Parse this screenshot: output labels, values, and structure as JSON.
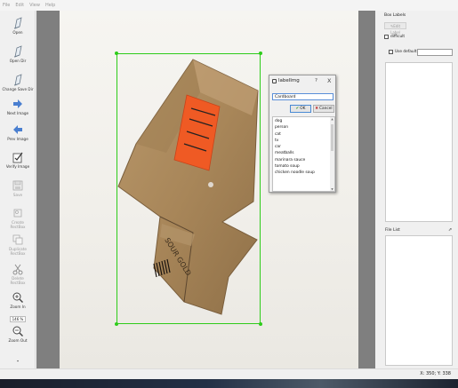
{
  "menu": [
    "File",
    "Edit",
    "View",
    "Help"
  ],
  "toolbar": {
    "open": "Open",
    "open_dir": "Open Dir",
    "change_save_dir": "Change Save Dir",
    "next_image": "Next Image",
    "prev_image": "Prev Image",
    "verify_image": "Verify Image",
    "save": "Save",
    "create_rectbox": "Create\nRectBox",
    "duplicate_rectbox": "Duplicate\nRectBox",
    "delete_rectbox": "Delete\nRectBox",
    "zoom_in": "Zoom In",
    "zoom_value": "146 %",
    "zoom_out": "Zoom Out"
  },
  "dialog": {
    "title": "labelImg",
    "help": "?",
    "close": "X",
    "input_value": "Cardboard",
    "ok_label": "OK",
    "cancel_label": "Cancel",
    "labels": [
      "dog",
      "person",
      "cat",
      "tv",
      "car",
      "meatballs",
      "marinara sauce",
      "tomato soup",
      "chicken noodle soup"
    ]
  },
  "right_panel": {
    "box_labels_title": "Box Labels",
    "edit_label": "Edit Label",
    "difficult": "difficult",
    "use_default_label": "Use default label",
    "file_list_title": "File List",
    "float_icon": "⇗"
  },
  "status": {
    "coords": "X: 350; Y: 338"
  },
  "colors": {
    "bbox": "#2ecc1a",
    "canvas_bg": "#7f7f7f",
    "label_orange": "#ef5a24"
  },
  "icons": {
    "open": "document-icon",
    "open_dir": "folder-document-icon",
    "change_save_dir": "folder-document-icon",
    "next_image": "arrow-right-icon",
    "prev_image": "arrow-left-icon",
    "verify_image": "verify-icon",
    "save": "save-icon",
    "create_rectbox": "rectbox-icon",
    "duplicate_rectbox": "duplicate-icon",
    "delete_rectbox": "scissors-icon",
    "zoom_in": "zoom-in-icon",
    "zoom_out": "zoom-out-icon"
  }
}
